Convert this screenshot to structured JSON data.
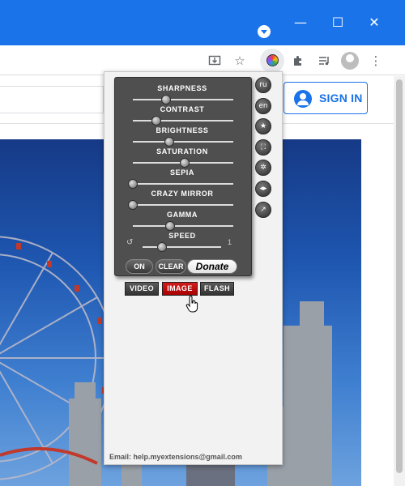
{
  "window": {
    "minimize_glyph": "—",
    "maximize_glyph": "☐",
    "close_glyph": "✕"
  },
  "toolbar": {
    "icons": [
      "install-app-icon",
      "bookmark-star-icon",
      "color-wheel-extension-icon",
      "extensions-puzzle-icon",
      "media-queue-icon",
      "profile-avatar-icon",
      "kebab-menu-icon"
    ]
  },
  "page": {
    "sign_in_label": "SIGN IN",
    "accent_color": "#1a73e8"
  },
  "extension": {
    "sliders": [
      {
        "label": "SHARPNESS",
        "value": 0.33
      },
      {
        "label": "CONTRAST",
        "value": 0.23
      },
      {
        "label": "BRIGHTNESS",
        "value": 0.36
      },
      {
        "label": "SATURATION",
        "value": 0.52
      },
      {
        "label": "SEPIA",
        "value": 0.0
      },
      {
        "label": "CRAZY MIRROR",
        "value": 0.0
      },
      {
        "label": "GAMMA",
        "value": 0.37
      },
      {
        "label": "SPEED",
        "value": 0.25
      }
    ],
    "speed_value": "1",
    "on_label": "ON",
    "clear_label": "CLEAR",
    "donate_label": "Donate",
    "side_buttons": [
      {
        "name": "lang-ru-button",
        "label": "ru"
      },
      {
        "name": "lang-en-button",
        "label": "en"
      },
      {
        "name": "star-button",
        "label": "★"
      },
      {
        "name": "fullscreen-button",
        "label": "⛶"
      },
      {
        "name": "settings-button",
        "label": "✲"
      },
      {
        "name": "mirror-toggle-button",
        "label": "◂▸"
      },
      {
        "name": "external-link-button",
        "label": "↗"
      }
    ],
    "mode_tabs": {
      "video": "VIDEO",
      "image": "IMAGE",
      "flash": "FLASH",
      "active": "IMAGE"
    },
    "email_line": "Email:  help.myextensions@gmail.com",
    "active_tab_color": "#c00000"
  }
}
